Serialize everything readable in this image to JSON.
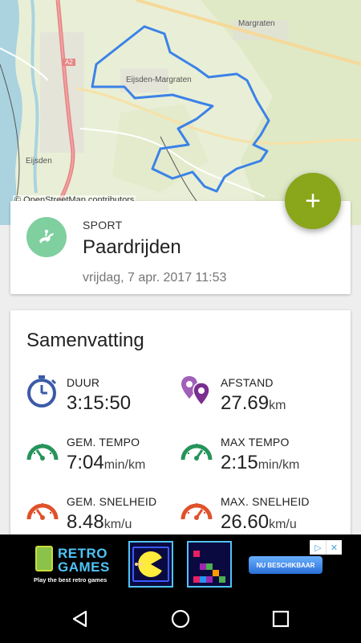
{
  "map": {
    "labels": [
      "Margraten",
      "Eijsden-Margraten",
      "Eijsden"
    ],
    "road_label": "A2",
    "attribution": "© OpenStreetMap contributors"
  },
  "fab": {
    "icon": "plus-icon",
    "label": "+"
  },
  "sport": {
    "label": "SPORT",
    "name": "Paardrijden",
    "date": "vrijdag, 7 apr. 2017 11:53",
    "icon": "horse-riding-icon",
    "icon_color": "#7fcf9f"
  },
  "summary": {
    "title": "Samenvatting",
    "stats": [
      {
        "label": "DUUR",
        "value": "3:15:50",
        "unit": "",
        "icon": "stopwatch-icon",
        "color": "#3b5aa8"
      },
      {
        "label": "AFSTAND",
        "value": "27.69",
        "unit": "km",
        "icon": "map-pins-icon",
        "color": "#8e3fa0"
      },
      {
        "label": "GEM. TEMPO",
        "value": "7:04",
        "unit": "min/km",
        "icon": "speedometer-icon",
        "color": "#26945a"
      },
      {
        "label": "MAX TEMPO",
        "value": "2:15",
        "unit": "min/km",
        "icon": "speedometer-icon",
        "color": "#26945a"
      },
      {
        "label": "GEM. SNELHEID",
        "value": "8.48",
        "unit": "km/u",
        "icon": "speedometer-icon",
        "color": "#e0512a"
      },
      {
        "label": "MAX. SNELHEID",
        "value": "26.60",
        "unit": "km/u",
        "icon": "speedometer-icon",
        "color": "#e0512a"
      }
    ]
  },
  "ad": {
    "brand_line1": "RETRO",
    "brand_line2": "GAMES",
    "tagline": "Play the best retro games",
    "cta": "NU BESCHIKBAAR",
    "choices_icon": "ad-choices-icon",
    "close_icon": "close-icon"
  },
  "navbar": {
    "back_icon": "back-icon",
    "home_icon": "home-icon",
    "recents_icon": "recents-icon"
  }
}
